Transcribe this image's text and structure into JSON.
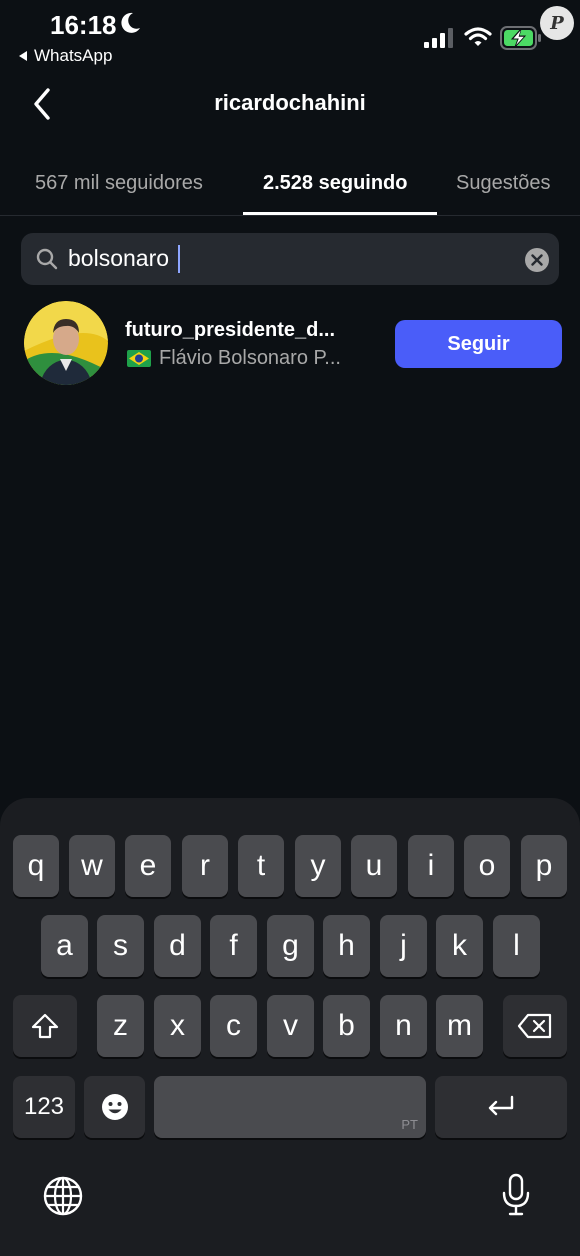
{
  "status_bar": {
    "time": "16:18",
    "back_app": "WhatsApp",
    "watermark": "P"
  },
  "header": {
    "title": "ricardochahini"
  },
  "tabs": [
    {
      "label": "567 mil seguidores",
      "active": false
    },
    {
      "label": "2.528 seguindo",
      "active": true
    },
    {
      "label": "Sugestões",
      "active": false
    }
  ],
  "search": {
    "value": "bolsonaro"
  },
  "results": [
    {
      "username": "futuro_presidente_d...",
      "full_name": "Flávio Bolsonaro P...",
      "flag_icon": "brazil-flag-icon",
      "button_label": "Seguir"
    }
  ],
  "keyboard": {
    "row1": [
      "q",
      "w",
      "e",
      "r",
      "t",
      "y",
      "u",
      "i",
      "o",
      "p"
    ],
    "row2": [
      "a",
      "s",
      "d",
      "f",
      "g",
      "h",
      "j",
      "k",
      "l"
    ],
    "row3": [
      "z",
      "x",
      "c",
      "v",
      "b",
      "n",
      "m"
    ],
    "numbers_label": "123",
    "space_hint": "PT"
  },
  "colors": {
    "background": "#0c1014",
    "accent": "#4a5df9",
    "keyboard_bg": "#1b1d21",
    "key": "#4a4b4f"
  }
}
